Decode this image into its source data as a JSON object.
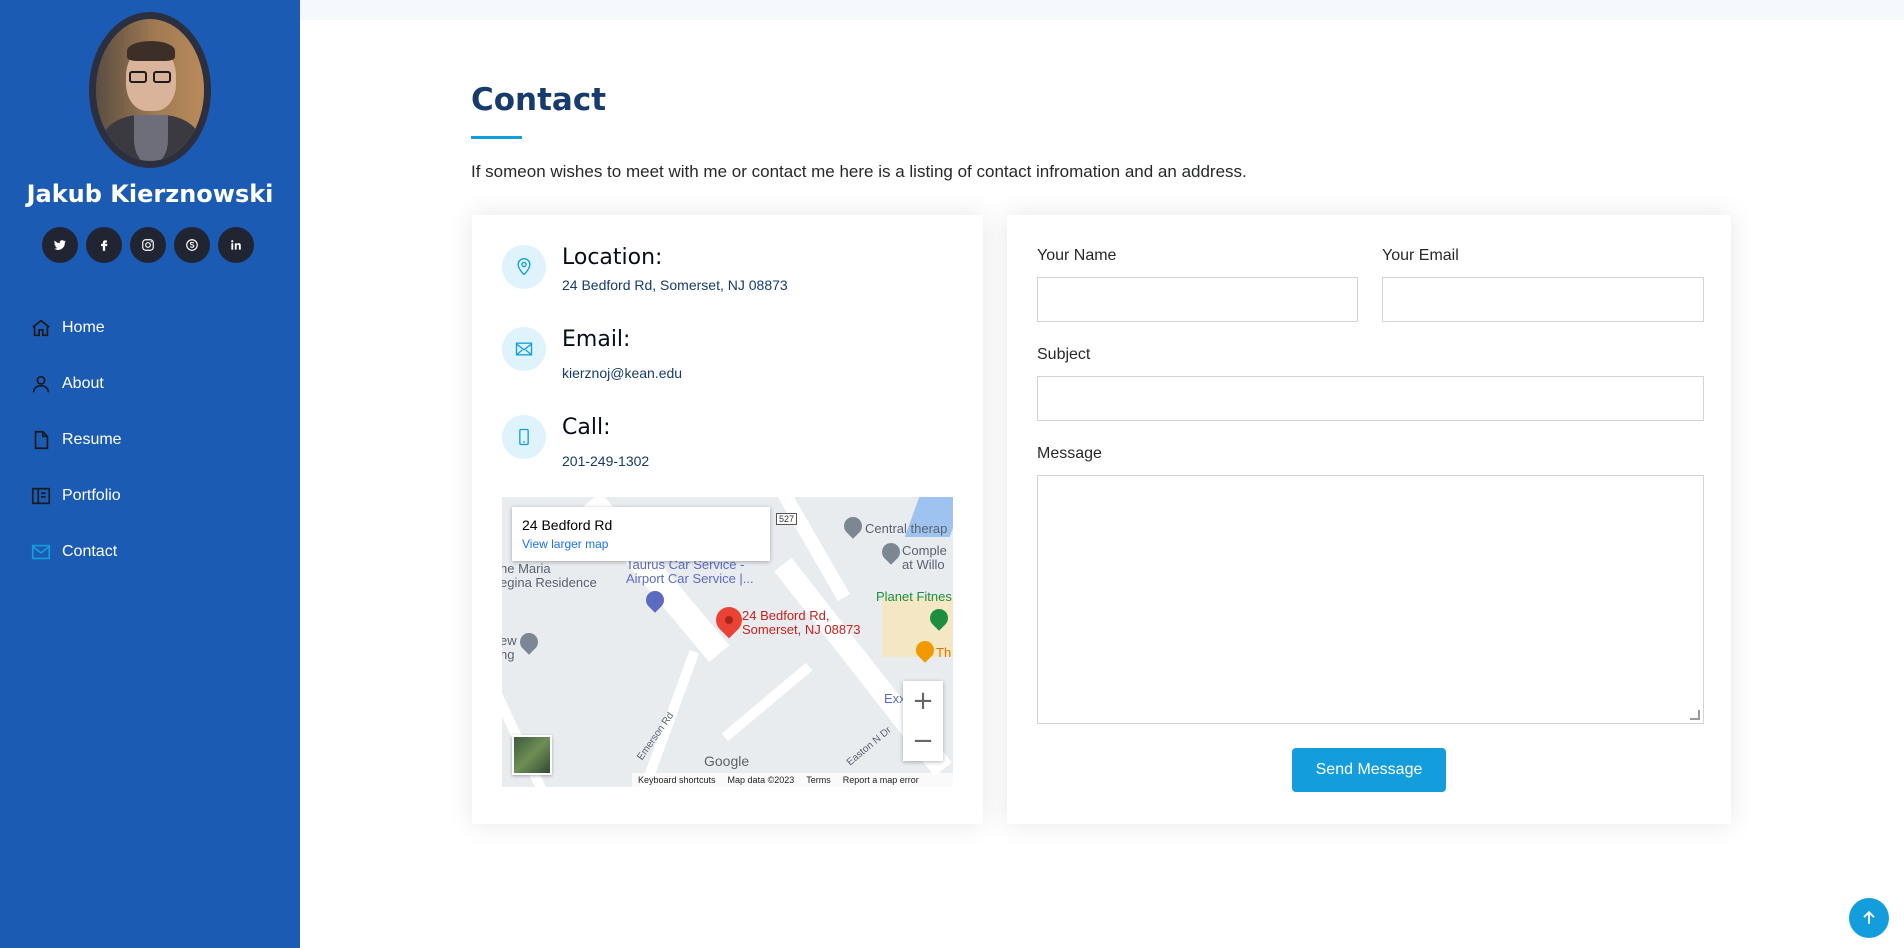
{
  "sidebar": {
    "name": "Jakub Kierznowski",
    "socials": [
      {
        "icon": "twitter-icon",
        "glyph": "t"
      },
      {
        "icon": "facebook-icon",
        "glyph": "f"
      },
      {
        "icon": "instagram-icon",
        "glyph": "◎"
      },
      {
        "icon": "skype-icon",
        "glyph": "S"
      },
      {
        "icon": "linkedin-icon",
        "glyph": "in"
      }
    ],
    "nav": [
      {
        "label": "Home",
        "icon": "house-icon"
      },
      {
        "label": "About",
        "icon": "person-icon"
      },
      {
        "label": "Resume",
        "icon": "file-icon"
      },
      {
        "label": "Portfolio",
        "icon": "book-icon"
      },
      {
        "label": "Contact",
        "icon": "envelope-icon",
        "active": true
      }
    ],
    "bg_color": "#1b5bb3"
  },
  "contact": {
    "title": "Contact",
    "intro": "If someon wishes to meet with me or contact me here is a listing of contact infromation and an address.",
    "location_label": "Location:",
    "location_value": "24 Bedford Rd, Somerset, NJ 08873",
    "email_label": "Email:",
    "email_value": "kierznoj@kean.edu",
    "call_label": "Call:",
    "call_value": "201-249-1302"
  },
  "map": {
    "infobox_title": "24 Bedford Rd",
    "infobox_link": "View larger map",
    "pin_label_1": "24 Bedford Rd,",
    "pin_label_2": "Somerset, NJ 08873",
    "labels": {
      "maria_1": "he Maria",
      "maria_2": "egina Residence",
      "taurus_1": "Taurus Car Service -",
      "taurus_2": "Airport Car Service |...",
      "central": "Central therap",
      "comple_1": "Comple",
      "comple_2": "at Willo",
      "planet": "Planet Fitnes",
      "th": "Th",
      "exx": "Exx",
      "ew": "ew",
      "ng": "ng",
      "emerson": "Emerson Rd",
      "route": "527",
      "easton": "Easton N Dr"
    },
    "google": "Google",
    "footer": [
      "Keyboard shortcuts",
      "Map data ©2023",
      "Terms",
      "Report a map error"
    ],
    "zoom_in": "+",
    "zoom_out": "−"
  },
  "form": {
    "name_label": "Your Name",
    "email_label": "Your Email",
    "subject_label": "Subject",
    "message_label": "Message",
    "name_value": "",
    "email_value": "",
    "subject_value": "",
    "message_value": "",
    "send_label": "Send Message"
  },
  "colors": {
    "accent": "#149ddd",
    "heading": "#173b6c"
  }
}
